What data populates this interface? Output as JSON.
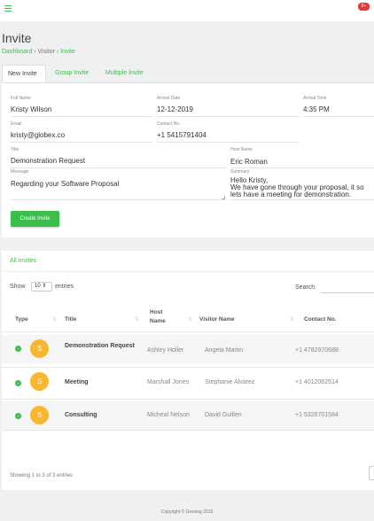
{
  "header": {
    "notification_badge": "8+"
  },
  "page": {
    "title": "Invite",
    "breadcrumb": {
      "dashboard": "Dashboard",
      "sep": "›",
      "visitor": "Visitor",
      "current": "Invite"
    }
  },
  "tabs": [
    {
      "label": "New Invite",
      "active": true
    },
    {
      "label": "Group Invite",
      "active": false
    },
    {
      "label": "Multiple Invite",
      "active": false
    }
  ],
  "form": {
    "full_name": {
      "label": "Full Name",
      "value": "Kristy Wilson"
    },
    "arrival_date": {
      "label": "Arrival Date",
      "value": "12-12-2019"
    },
    "arrival_time": {
      "label": "Arrival Time",
      "value": "4:35 PM"
    },
    "email": {
      "label": "Email",
      "value": "kristy@globex.co"
    },
    "contact": {
      "label": "Contact No.",
      "value": "+1 5415791404"
    },
    "title": {
      "label": "Title",
      "value": "Demonstration Request"
    },
    "host": {
      "label": "Host Name",
      "value": "Eric Roman"
    },
    "message": {
      "label": "Message",
      "value": "Regarding your Software Proposal"
    },
    "summary": {
      "label": "Summary",
      "line1": "Hello Kristy,",
      "line2": "We have gone through your proposal, it so",
      "line3": "lets have a meeting for demonstration."
    },
    "create_button": "Create Invite"
  },
  "list": {
    "title": "All Invites",
    "show_label": "Show",
    "page_size": "10",
    "entries_label": "entries",
    "search_label": "Search:",
    "columns": {
      "type": "Type",
      "title": "Title",
      "host": "Host\nName",
      "visitor": "Visitor Name",
      "contact": "Contact No."
    },
    "rows": [
      {
        "avatar": "S",
        "title": "Demonstration Request",
        "host": "Ashley Holler",
        "visitor": "Angela Martin",
        "contact": "+1 4782970688"
      },
      {
        "avatar": "S",
        "title": "Meeting",
        "host": "Marshall Jones",
        "visitor": "Stephanie Alvarez",
        "contact": "+1 4012062514"
      },
      {
        "avatar": "S",
        "title": "Consulting",
        "host": "Micheal Nelson",
        "visitor": "David Guillen",
        "contact": "+1 5326701584"
      }
    ],
    "info": "Showing 1 to 3 of 3 entries"
  },
  "footer": "Copyright © Greetog 2019",
  "colors": {
    "accent": "#3cbf4a",
    "avatar": "#f7b731",
    "badge": "#e53935"
  }
}
